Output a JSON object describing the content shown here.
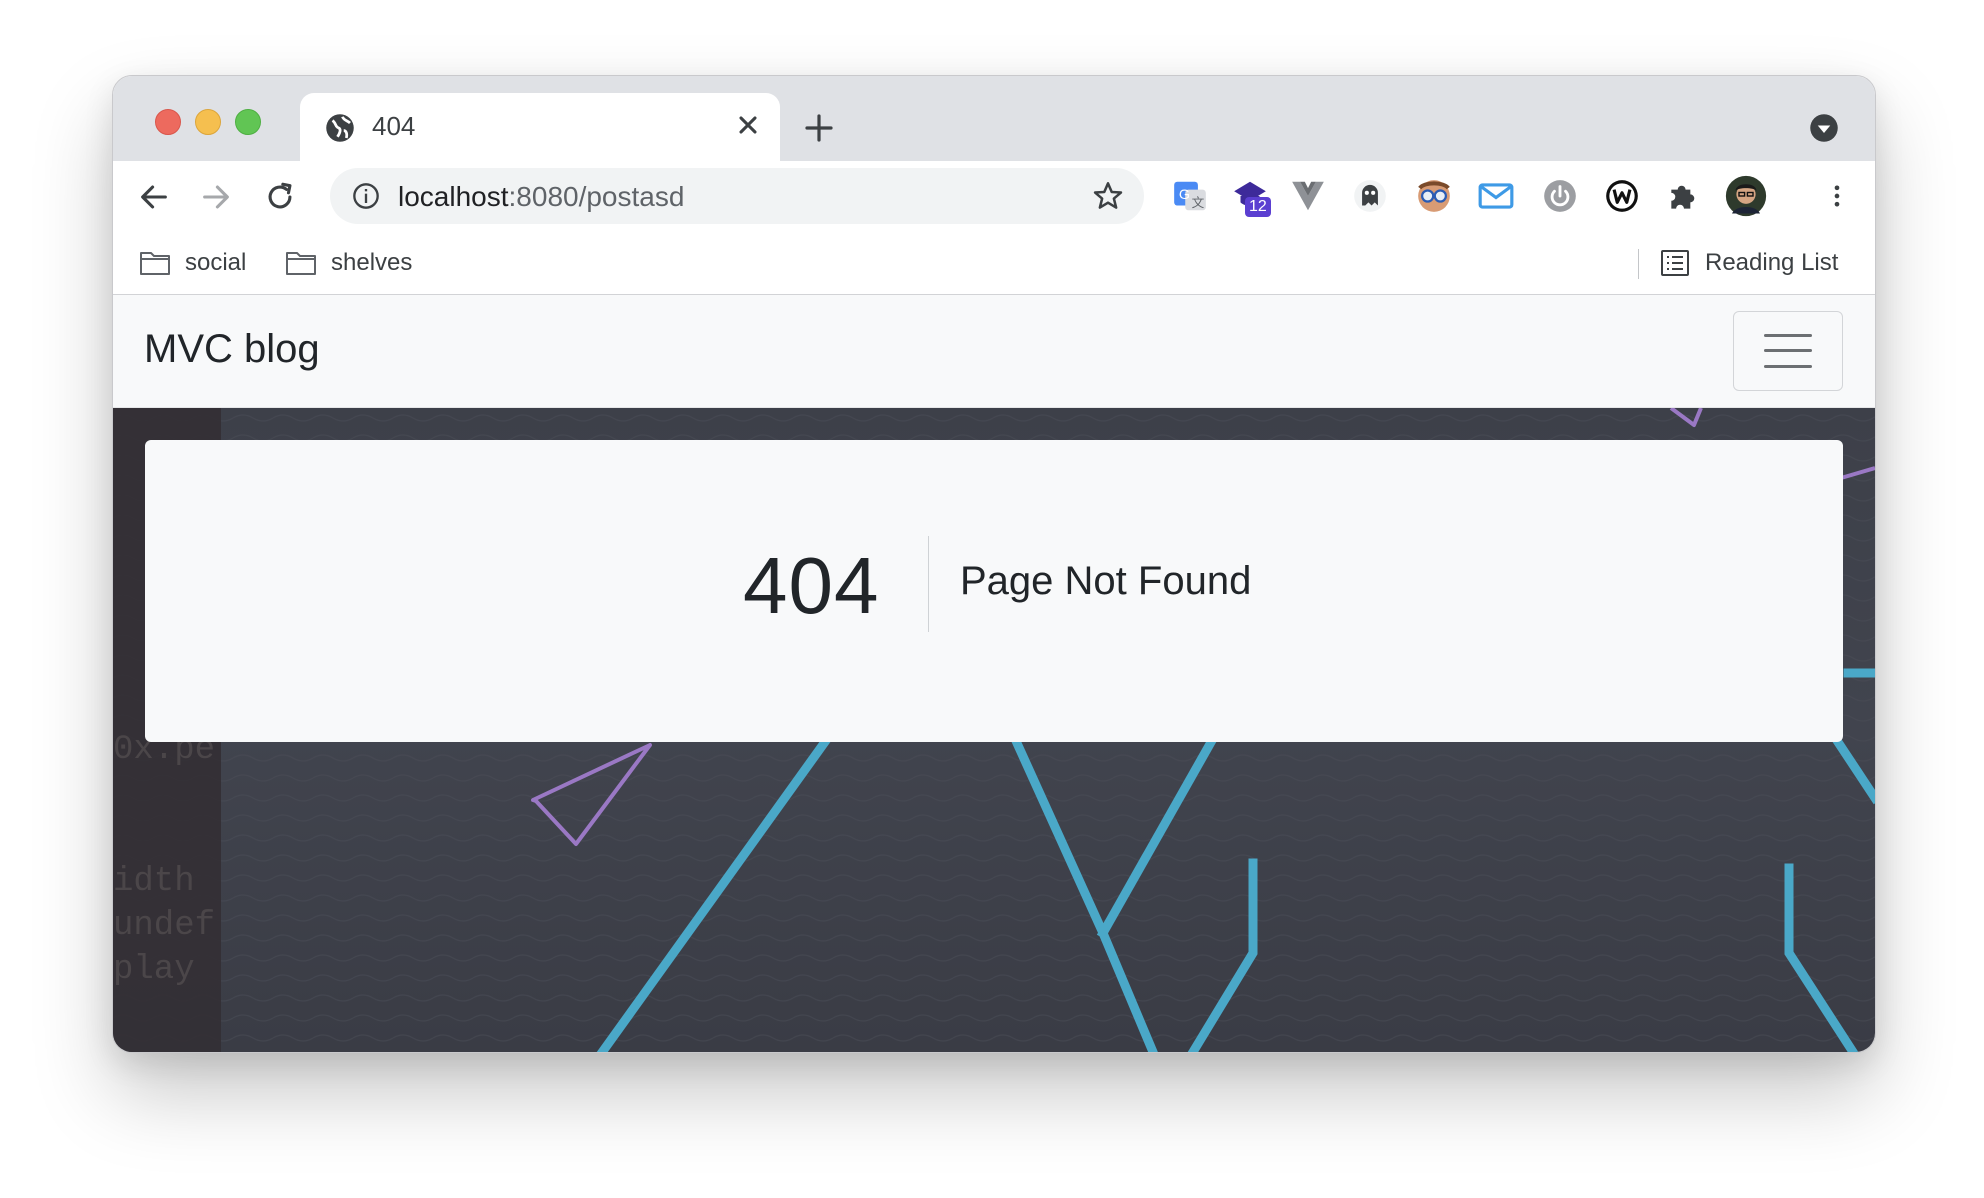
{
  "browser": {
    "tab": {
      "title": "404"
    },
    "omnibox": {
      "host": "localhost",
      "path": ":8080/postasd"
    },
    "extensions": [
      {
        "name": "google-translate-icon"
      },
      {
        "name": "graduation-cap-icon",
        "badge": "12"
      },
      {
        "name": "vue-devtools-icon"
      },
      {
        "name": "ghostery-icon"
      },
      {
        "name": "glasses-extension-icon"
      },
      {
        "name": "mail-icon"
      },
      {
        "name": "power-icon"
      },
      {
        "name": "wappalyzer-icon"
      },
      {
        "name": "extensions-puzzle-icon"
      }
    ],
    "bookmarks": [
      {
        "label": "social"
      },
      {
        "label": "shelves"
      }
    ],
    "reading_list": "Reading List"
  },
  "page": {
    "brand": "MVC blog",
    "error": {
      "code": "404",
      "message": "Page Not Found"
    }
  },
  "colors": {
    "accent_line": "#4aa8c8",
    "triangle_stroke": "#9a78c4",
    "hero_bg": "#3d4049"
  }
}
